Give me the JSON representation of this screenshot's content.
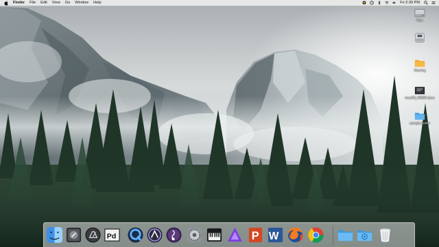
{
  "menubar": {
    "app_name": "Finder",
    "items": [
      "File",
      "Edit",
      "View",
      "Go",
      "Window",
      "Help"
    ],
    "clock": "Fri 2:39 PM",
    "status_icons": [
      "app-status-icon",
      "time-machine-icon",
      "bluetooth-icon",
      "wifi-icon",
      "volume-icon"
    ],
    "right_icons": [
      "spotlight-icon",
      "notification-center-icon"
    ]
  },
  "desktop": {
    "icons": [
      {
        "name": "hard-drive",
        "label": "Mac"
      },
      {
        "name": "disk-image",
        "label": ""
      },
      {
        "name": "folder",
        "label": "Sharing"
      },
      {
        "name": "document",
        "label": "macOS_WSEM.docx"
      },
      {
        "name": "folder",
        "label": "sample folder"
      }
    ]
  },
  "dock": {
    "apps": [
      "Finder",
      "Launchpad",
      "Tempo",
      "Pd",
      "QuickTime",
      "Pro Tools",
      "Sibelius",
      "System Preferences",
      "MIDI Keyboard",
      "Affinity",
      "PowerPoint",
      "Word",
      "Firefox",
      "Chrome"
    ],
    "right": [
      "Applications",
      "Downloads",
      "Trash"
    ]
  },
  "colors": {
    "sky": "#c9ced1",
    "forest": "#233a2c",
    "menubar": "#ececec"
  }
}
